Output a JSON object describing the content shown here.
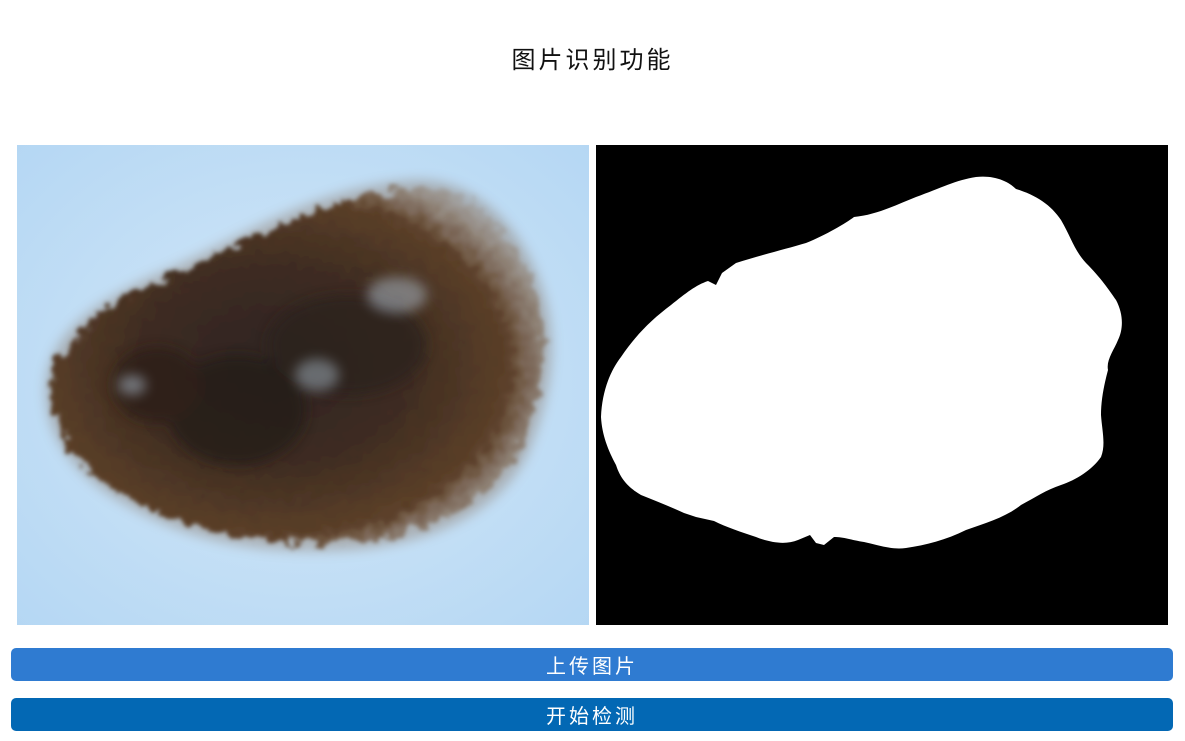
{
  "header": {
    "title": "图片识别功能"
  },
  "images": {
    "original": {
      "name": "skin-lesion-photo",
      "background_color": "#bcdcf4",
      "lesion_color": "#4a3322"
    },
    "mask": {
      "name": "segmentation-mask",
      "background_color": "#000000",
      "mask_color": "#ffffff"
    }
  },
  "actions": {
    "upload_label": "上传图片",
    "detect_label": "开始检测",
    "upload_color": "#2f7bd1",
    "detect_color": "#0368b4"
  }
}
